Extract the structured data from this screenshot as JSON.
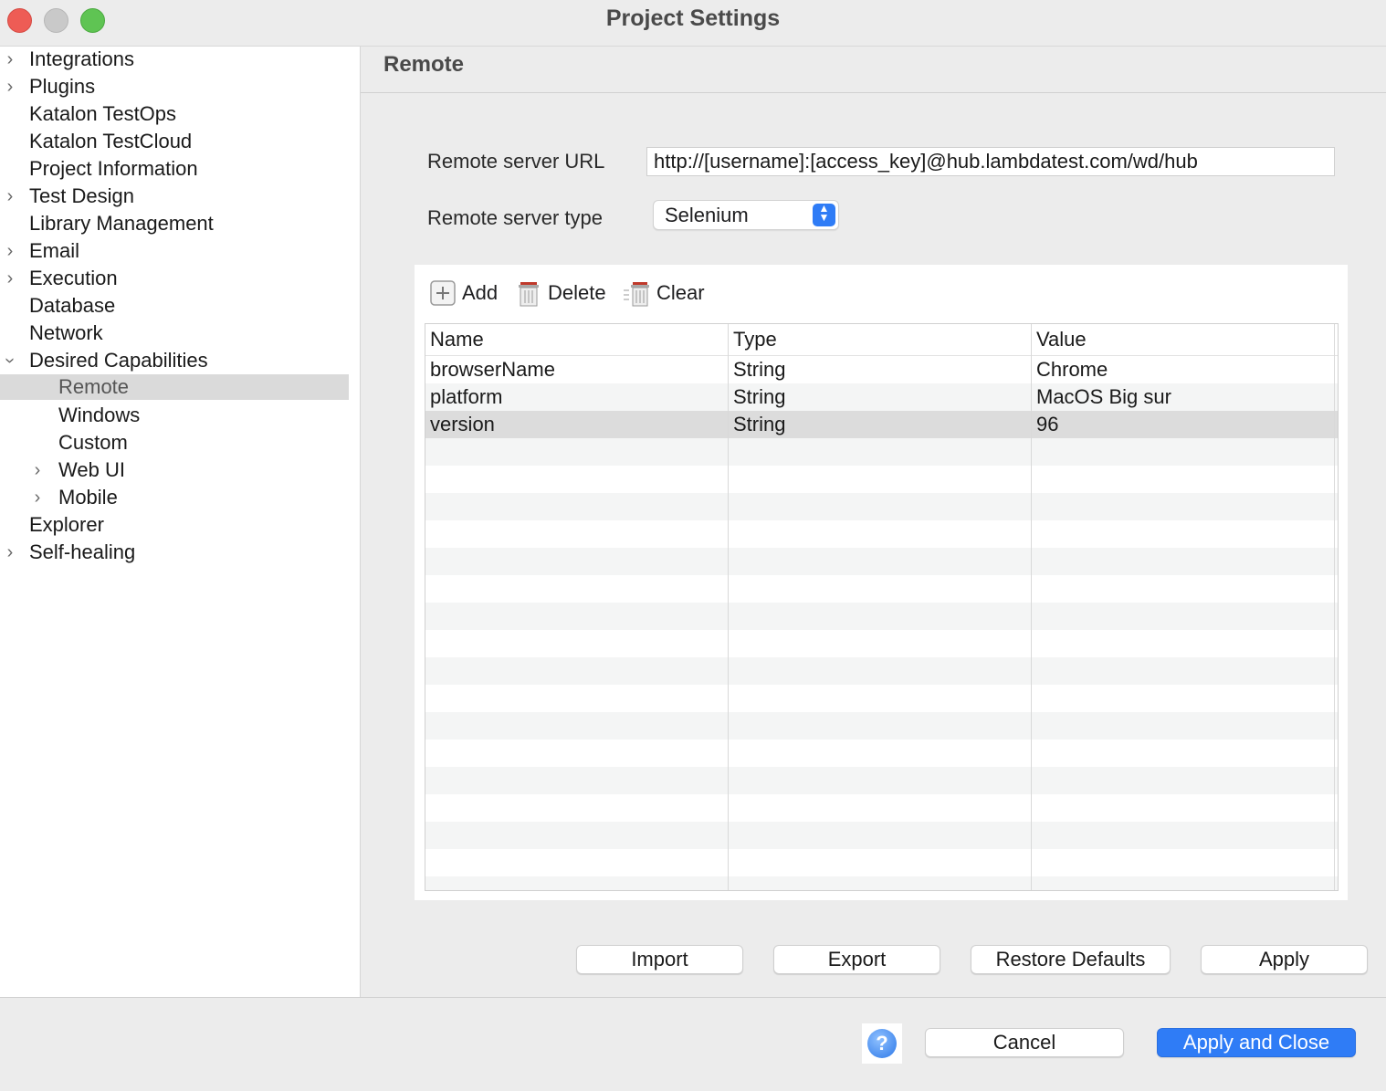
{
  "window": {
    "title": "Project Settings"
  },
  "sidebar": {
    "items": [
      {
        "label": "Integrations",
        "expandable": true
      },
      {
        "label": "Plugins",
        "expandable": true
      },
      {
        "label": "Katalon TestOps",
        "expandable": false
      },
      {
        "label": "Katalon TestCloud",
        "expandable": false
      },
      {
        "label": "Project Information",
        "expandable": false
      },
      {
        "label": "Test Design",
        "expandable": true
      },
      {
        "label": "Library Management",
        "expandable": false
      },
      {
        "label": "Email",
        "expandable": true
      },
      {
        "label": "Execution",
        "expandable": true
      },
      {
        "label": "Database",
        "expandable": false
      },
      {
        "label": "Network",
        "expandable": false
      },
      {
        "label": "Desired Capabilities",
        "expandable": true,
        "expanded": true
      },
      {
        "label": "Remote",
        "selected": true
      },
      {
        "label": "Windows"
      },
      {
        "label": "Custom"
      },
      {
        "label": "Web UI",
        "expandable": true
      },
      {
        "label": "Mobile",
        "expandable": true
      },
      {
        "label": "Explorer",
        "expandable": false
      },
      {
        "label": "Self-healing",
        "expandable": true
      }
    ]
  },
  "main": {
    "title": "Remote",
    "remote_url": {
      "label": "Remote server URL",
      "value": "http://[username]:[access_key]@hub.lambdatest.com/wd/hub"
    },
    "remote_type": {
      "label": "Remote server type",
      "value": "Selenium"
    },
    "toolbar": {
      "add": "Add",
      "delete": "Delete",
      "clear": "Clear"
    },
    "table": {
      "columns": [
        "Name",
        "Type",
        "Value"
      ],
      "rows": [
        {
          "name": "browserName",
          "type": "String",
          "value": "Chrome"
        },
        {
          "name": "platform",
          "type": "String",
          "value": "MacOS Big sur"
        },
        {
          "name": "version",
          "type": "String",
          "value": "96",
          "selected": true
        }
      ]
    },
    "buttons": {
      "import": "Import",
      "export": "Export",
      "restore_defaults": "Restore Defaults",
      "apply": "Apply"
    }
  },
  "footer": {
    "help_icon": "question-mark",
    "cancel": "Cancel",
    "apply_and_close": "Apply and Close"
  },
  "colors": {
    "accent": "#2f7cf6",
    "selection": "#dadada",
    "close": "#ee5c55",
    "maximize": "#5fc453"
  }
}
